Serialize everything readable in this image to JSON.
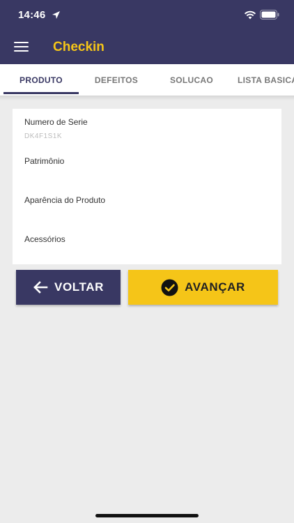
{
  "status_bar": {
    "time": "14:46"
  },
  "header": {
    "title": "Checkin",
    "title_color": "#f5c518",
    "bar_color": "#393863"
  },
  "tabs": [
    {
      "label": "PRODUTO"
    },
    {
      "label": "DEFEITOS"
    },
    {
      "label": "SOLUCAO"
    },
    {
      "label": "LISTA BASICA"
    }
  ],
  "form": {
    "fields": [
      {
        "label": "Numero de Serie",
        "value": "DK4F1S1K"
      },
      {
        "label": "Patrimônio",
        "value": ""
      },
      {
        "label": "Aparência do Produto",
        "value": ""
      },
      {
        "label": "Acessórios",
        "value": ""
      }
    ]
  },
  "buttons": {
    "back_label": "VOLTAR",
    "next_label": "AVANÇAR",
    "back_color": "#393863",
    "next_color": "#f5c518"
  },
  "icons": [
    "menu-icon",
    "location-arrow-icon",
    "wifi-icon",
    "battery-icon",
    "arrow-left-icon",
    "check-circle-icon"
  ]
}
